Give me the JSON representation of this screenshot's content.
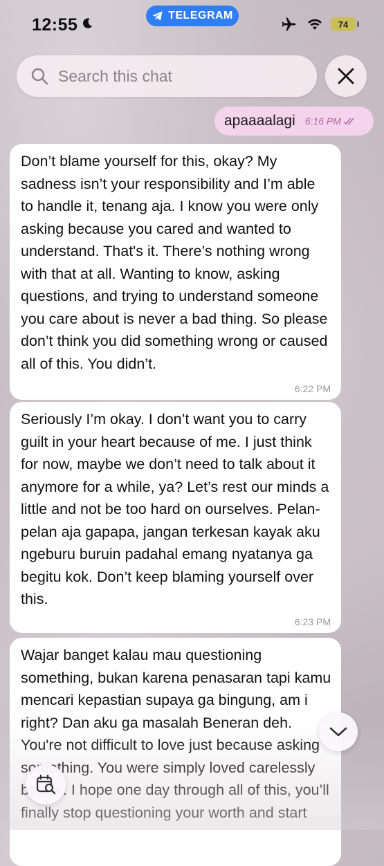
{
  "status_bar": {
    "time": "12:55",
    "app_pill": "TELEGRAM",
    "battery": "74"
  },
  "search": {
    "placeholder": "Search this chat"
  },
  "messages": {
    "outgoing": [
      {
        "text": "apaaaalagi",
        "time": "6:16 PM"
      }
    ],
    "incoming": [
      {
        "text": "Don’t blame yourself for this, okay? My sadness isn’t your responsibility and I’m able to handle it, tenang aja. I know you were only asking because you cared and wanted to understand. That's it. There’s nothing wrong with that at all. Wanting to know, asking questions, and trying to understand someone you care about is never a bad thing. So please don’t think you did something wrong or caused all of this. You didn’t.",
        "time": "6:22 PM"
      },
      {
        "text": "Seriously I’m okay. I don’t want you to carry guilt in your heart because of me. I just think for now, maybe we don’t need to talk about it anymore for a while, ya? Let’s rest our minds a little and not be too hard on ourselves. Pelan-pelan aja gapapa, jangan terkesan kayak aku ngeburu buruin padahal emang nyatanya ga begitu kok. Don’t keep blaming yourself over this.",
        "time": "6:23 PM"
      },
      {
        "text": "Wajar banget kalau mau questioning something, bukan karena penasaran tapi kamu mencari kepastian supaya ga bingung, am i right? Dan aku ga masalah Beneran deh. You're not difficult to love just because asking something. You were simply loved carelessly before. I hope one day through all of this, you’ll finally stop questioning your worth and start",
        "time": ""
      }
    ]
  },
  "colors": {
    "telegram_blue": "#2f7ef5",
    "outgoing_bubble": "#f4d3ec",
    "incoming_bubble": "#ffffff",
    "battery": "#cbbd57"
  },
  "icons": [
    "moon-icon",
    "telegram-icon",
    "airplane-icon",
    "wifi-icon",
    "search-icon",
    "close-icon",
    "read-ticks-icon",
    "chevron-down-icon",
    "calendar-search-icon"
  ]
}
